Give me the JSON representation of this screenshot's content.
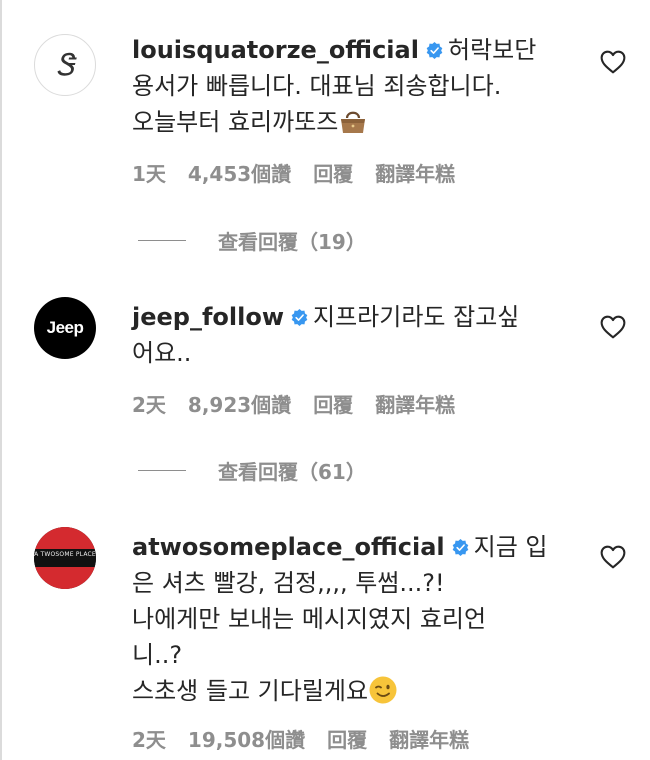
{
  "comments": [
    {
      "username": "louisquatorze_official",
      "avatar_text": "Ꮥ",
      "lines": [
        "허락보단",
        "용서가 빠릅니다. 대표님 죄송합니다.",
        "오늘부터 효리까또즈"
      ],
      "emoji": "handbag-emoji",
      "time": "1天",
      "likes": "4,453個讚",
      "reply": "回覆",
      "translate": "翻譯年糕",
      "view_replies": "查看回覆（19）"
    },
    {
      "username": "jeep_follow",
      "avatar_text": "Jeep",
      "lines": [
        "지프라기라도 잡고싶",
        "어요.."
      ],
      "time": "2天",
      "likes": "8,923個讚",
      "reply": "回覆",
      "translate": "翻譯年糕",
      "view_replies": "查看回覆（61）"
    },
    {
      "username": "atwosomeplace_official",
      "avatar_text": "A TWOSOME PLACE",
      "lines": [
        "지금 입",
        "은 셔츠 빨강, 검정,,,, 투썸...?!",
        "나에게만 보내는 메시지였지 효리언",
        "니..?",
        "스초생 들고 기다릴게요"
      ],
      "emoji": "winking-face-emoji",
      "time": "2天",
      "likes": "19,508個讚",
      "reply": "回覆",
      "translate": "翻譯年糕"
    }
  ],
  "colors": {
    "text": "#262626",
    "secondary": "#8e8e8e",
    "verified": "#3897f0",
    "border": "#dbdbdb"
  },
  "icons": [
    "verified-badge-icon",
    "heart-outline-icon"
  ]
}
